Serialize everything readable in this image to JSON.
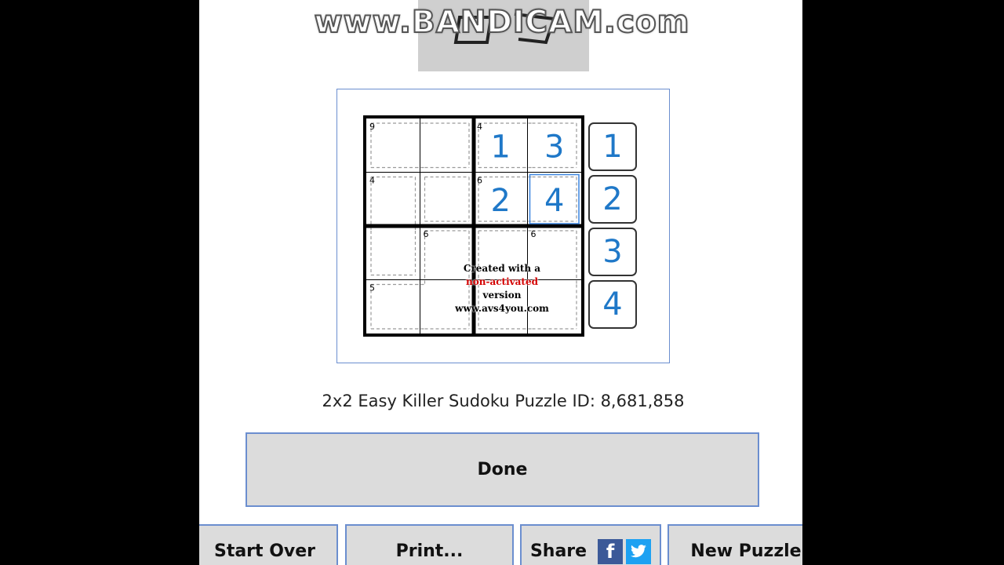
{
  "watermark": {
    "text": "www.BANDICAM.com"
  },
  "puzzle": {
    "cells": [
      [
        "",
        "",
        "1",
        "3"
      ],
      [
        "",
        "",
        "2",
        "4"
      ],
      [
        "",
        "",
        "",
        ""
      ],
      [
        "",
        "",
        "",
        ""
      ]
    ],
    "clues": [
      {
        "row": 0,
        "col": 0,
        "value": "9"
      },
      {
        "row": 0,
        "col": 2,
        "value": "4"
      },
      {
        "row": 1,
        "col": 0,
        "value": "4"
      },
      {
        "row": 1,
        "col": 2,
        "value": "6"
      },
      {
        "row": 2,
        "col": 1,
        "value": "6"
      },
      {
        "row": 2,
        "col": 3,
        "value": "6"
      },
      {
        "row": 3,
        "col": 0,
        "value": "5"
      }
    ],
    "selected": {
      "row": 1,
      "col": 3
    },
    "digit_color": "#1f78c8"
  },
  "palette": [
    "1",
    "2",
    "3",
    "4"
  ],
  "caption": "2x2 Easy Killer Sudoku Puzzle ID: 8,681,858",
  "buttons": {
    "done": "Done",
    "start_over": "Start Over",
    "print": "Print...",
    "share": "Share",
    "facebook_glyph": "f",
    "new_puzzle": "New Puzzle"
  },
  "avs_watermark": {
    "line1": "Created with a",
    "line2_red": "non-activated",
    "line2_rest": " version",
    "line3": "www.avs4you.com"
  }
}
